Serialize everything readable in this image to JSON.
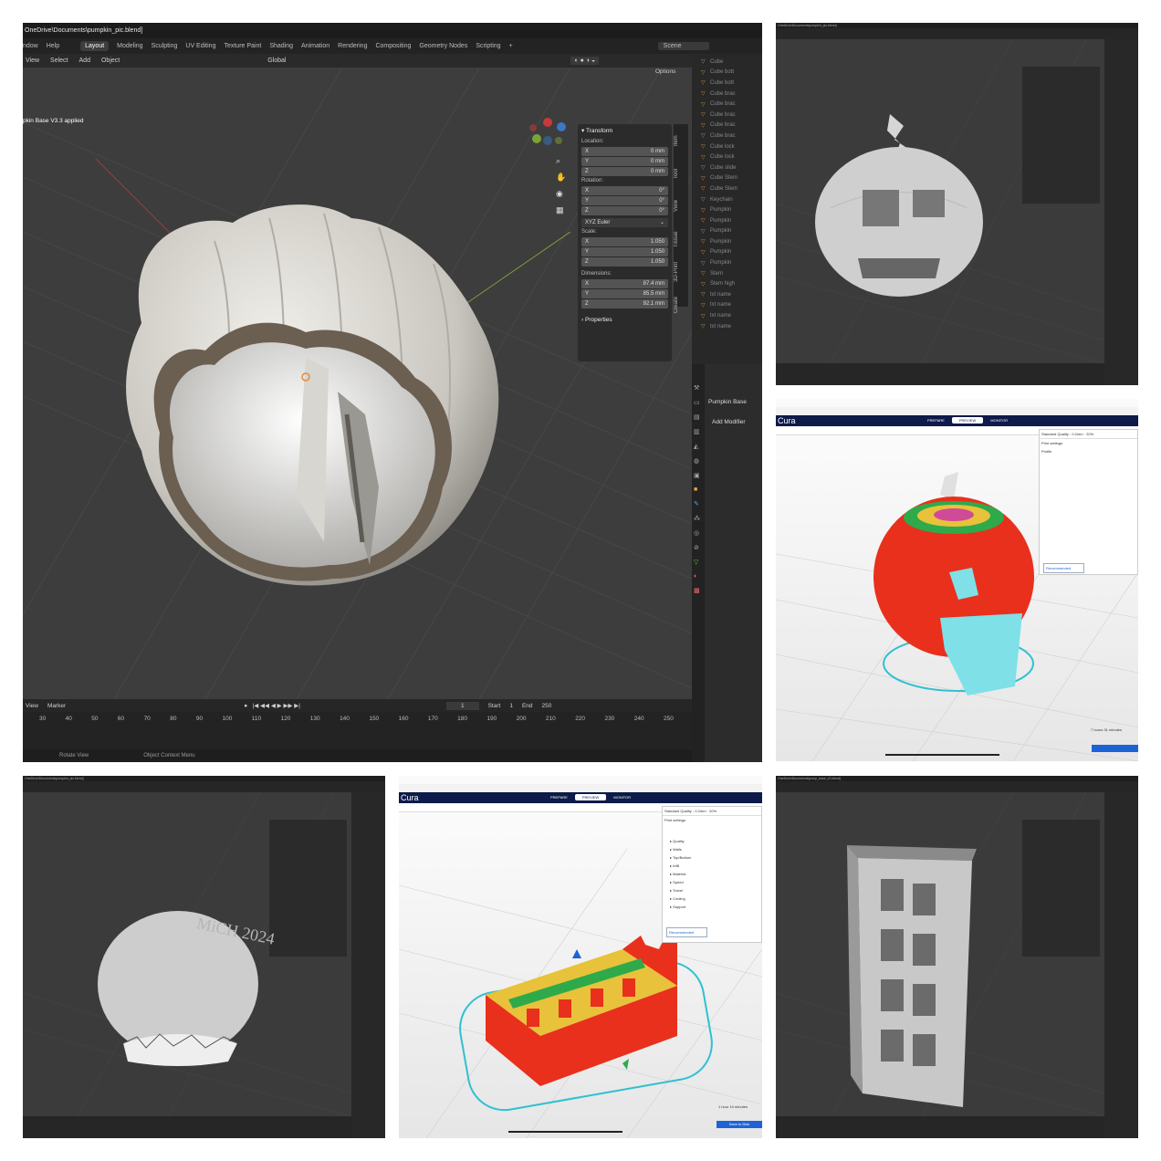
{
  "main": {
    "title": "OneDrive\\Documents\\pumpkin_pic.blend]",
    "menu_left": [
      "ndow",
      "Help"
    ],
    "workspaces": [
      "Layout",
      "Modeling",
      "Sculpting",
      "UV Editing",
      "Texture Paint",
      "Shading",
      "Animation",
      "Rendering",
      "Compositing",
      "Geometry Nodes",
      "Scripting"
    ],
    "scene_label": "Scene",
    "header_menus": [
      "View",
      "Select",
      "Add",
      "Object"
    ],
    "orientation": "Global",
    "options_label": "Options",
    "viewport_overlay_text": "pkin Base V3.3 applied",
    "n_panel": {
      "transform_label": "Transform",
      "location_label": "Location:",
      "location": [
        {
          "axis": "X",
          "value": "0 mm"
        },
        {
          "axis": "Y",
          "value": "0 mm"
        },
        {
          "axis": "Z",
          "value": "0 mm"
        }
      ],
      "rotation_label": "Rotation:",
      "rotation": [
        {
          "axis": "X",
          "value": "0°"
        },
        {
          "axis": "Y",
          "value": "0°"
        },
        {
          "axis": "Z",
          "value": "0°"
        }
      ],
      "rotation_mode": "XYZ Euler",
      "scale_label": "Scale:",
      "scale": [
        {
          "axis": "X",
          "value": "1.050"
        },
        {
          "axis": "Y",
          "value": "1.050"
        },
        {
          "axis": "Z",
          "value": "1.050"
        }
      ],
      "dimensions_label": "Dimensions:",
      "dimensions": [
        {
          "axis": "X",
          "value": "87.4 mm"
        },
        {
          "axis": "Y",
          "value": "85.5 mm"
        },
        {
          "axis": "Z",
          "value": "92.1 mm"
        }
      ],
      "properties_label": "Properties"
    },
    "side_tabs": [
      "Item",
      "Tool",
      "View",
      "Tissue",
      "3D-Print",
      "Create"
    ],
    "outliner_items": [
      "Cube",
      "Cube bott",
      "Cube bott",
      "Cube brac",
      "Cube brac",
      "Cube brac",
      "Cube brac",
      "Cube brac",
      "Cube lock",
      "Cube lock",
      "Cube slide",
      "Cube Stem",
      "Cube Stem",
      "Keychain",
      "Pumpkin",
      "Pumpkin",
      "Pumpkin",
      "Pumpkin",
      "Pumpkin",
      "Pumpkin",
      "Stem",
      "Stem high",
      "txt name",
      "txt name",
      "txt name",
      "txt name"
    ],
    "properties": {
      "object_name": "Pumpkin Base",
      "add_modifier": "Add Modifier"
    },
    "timeline": {
      "menus": [
        "View",
        "Marker"
      ],
      "current_frame": "1",
      "start_label": "Start",
      "start": "1",
      "end_label": "End",
      "end": "250",
      "ticks": [
        "30",
        "40",
        "50",
        "60",
        "70",
        "80",
        "90",
        "100",
        "110",
        "120",
        "130",
        "140",
        "150",
        "160",
        "170",
        "180",
        "190",
        "200",
        "210",
        "220",
        "230",
        "240",
        "250"
      ]
    },
    "status": [
      "Rotate View",
      "Object Context Menu"
    ]
  },
  "cura1": {
    "title": "Cura",
    "stages": [
      "PREPARE",
      "PREVIEW",
      "MONITOR"
    ],
    "profile": "Standard Quality - 0.2mm",
    "infill": "20%",
    "print_settings": "Print settings",
    "profile_label": "Profile",
    "recommended": "Recommended",
    "estimate": "7 hours 31 minutes"
  },
  "cura2": {
    "title": "Cura",
    "stages": [
      "PREPARE",
      "PREVIEW",
      "MONITOR"
    ],
    "profile": "Standard Quality - 0.2mm",
    "infill": "20%",
    "print_settings": "Print settings",
    "categories": [
      "Quality",
      "Walls",
      "Top/Bottom",
      "Infill",
      "Material",
      "Speed",
      "Travel",
      "Cooling",
      "Support"
    ],
    "recommended": "Recommended",
    "estimate": "1 hour 19 minutes",
    "save": "Save to Disk"
  },
  "thumbs": {
    "tr_title": "OneDrive\\Documents\\pumpkin_pic.blend]",
    "bl_title": "OneDrive\\Documents\\pumpkin_pic.blend]",
    "br_title": "OneDrive\\Documents\\pump_base_v2.blend]",
    "bl_text": "MiCH 2024"
  },
  "colors": {
    "blender_bg": "#3d3d3d",
    "cura_nav": "#0d1a4a",
    "print_red": "#e8301c",
    "support_cyan": "#7fe0e8"
  }
}
